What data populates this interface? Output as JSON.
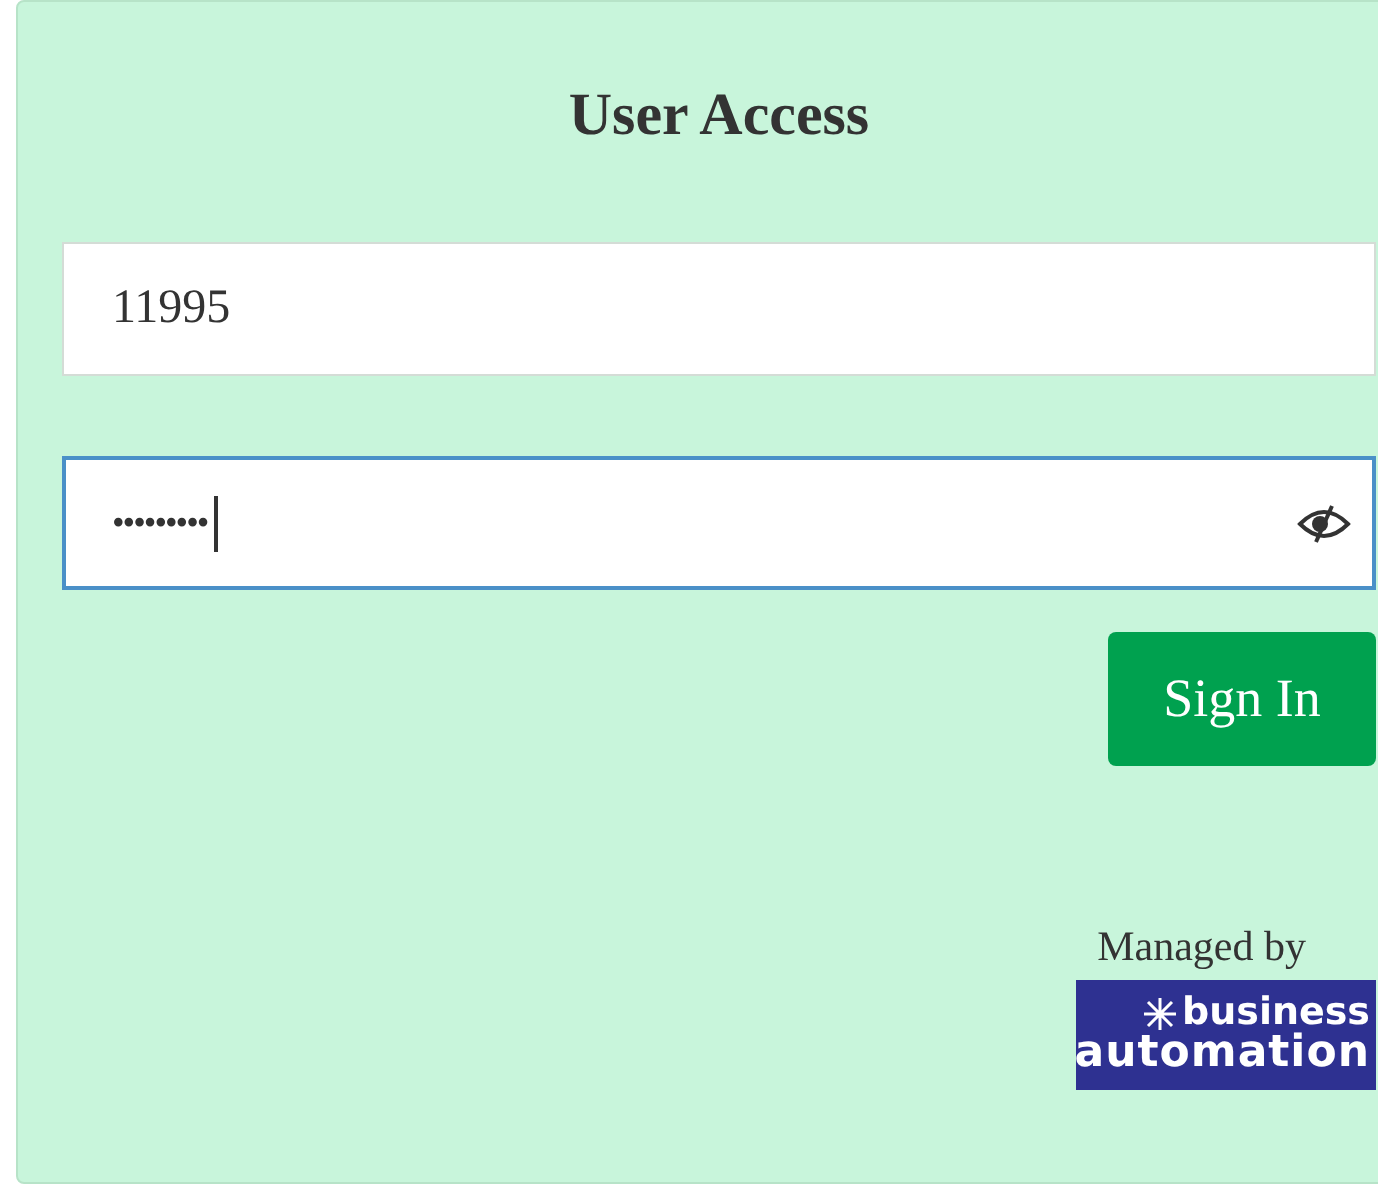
{
  "title": "User Access",
  "fields": [
    {
      "kind": "text",
      "value": "11995",
      "focused": false
    },
    {
      "kind": "password",
      "value": "•••••••••",
      "focused": true
    }
  ],
  "button": "Sign In",
  "managed_by": "Managed by",
  "logo": {
    "line_1": "business",
    "line_2": "automation"
  }
}
